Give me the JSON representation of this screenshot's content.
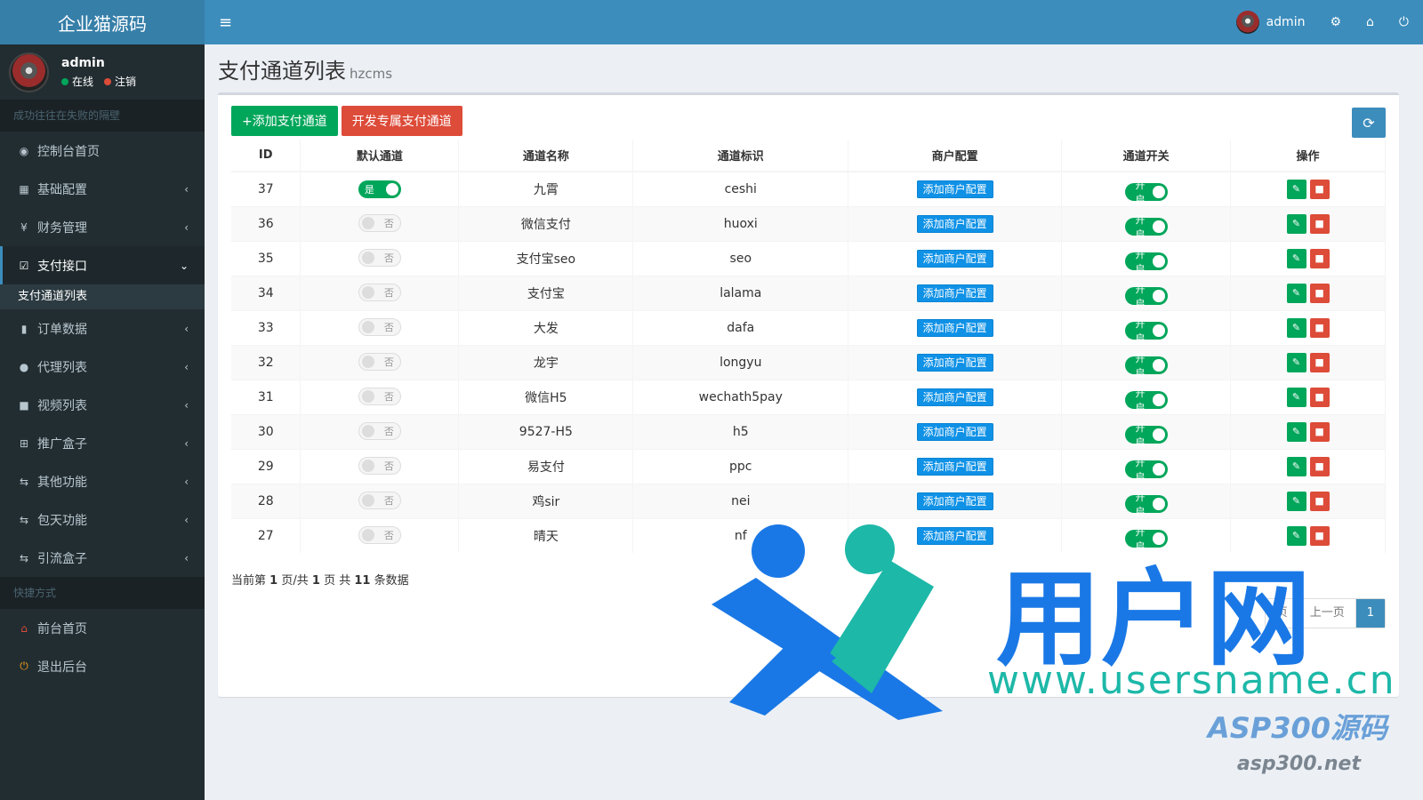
{
  "app": {
    "logo": "企业猫源码"
  },
  "user": {
    "name": "admin",
    "online": "在线",
    "logout": "注销"
  },
  "sidebar": {
    "motto": "成功往往在失败的隔壁",
    "items": [
      {
        "label": "控制台首页",
        "icon": "dashboard-icon"
      },
      {
        "label": "基础配置",
        "icon": "grid-icon"
      },
      {
        "label": "财务管理",
        "icon": "yen-icon"
      },
      {
        "label": "支付接口",
        "icon": "checkbox-icon"
      },
      {
        "label": "订单数据",
        "icon": "bar-chart-icon"
      },
      {
        "label": "代理列表",
        "icon": "users-icon"
      },
      {
        "label": "视频列表",
        "icon": "video-icon"
      },
      {
        "label": "推广盒子",
        "icon": "table-icon"
      },
      {
        "label": "其他功能",
        "icon": "exchange-icon"
      },
      {
        "label": "包天功能",
        "icon": "exchange-icon"
      },
      {
        "label": "引流盒子",
        "icon": "exchange-icon"
      }
    ],
    "active_sub": "支付通道列表",
    "quick_header": "快捷方式",
    "quick": [
      {
        "label": "前台首页"
      },
      {
        "label": "退出后台"
      }
    ]
  },
  "header": {
    "user": "admin"
  },
  "page": {
    "title": "支付通道列表",
    "subtitle": "hzcms"
  },
  "toolbar": {
    "add": "+添加支付通道",
    "dev": "开发专属支付通道"
  },
  "table": {
    "columns": [
      "ID",
      "默认通道",
      "通道名称",
      "通道标识",
      "商户配置",
      "通道开关",
      "操作"
    ],
    "merchant_btn": "添加商户配置",
    "on_label": "开启",
    "rows": [
      {
        "id": "37",
        "default": "是",
        "name": "九霄",
        "code": "ceshi"
      },
      {
        "id": "36",
        "default": "否",
        "name": "微信支付",
        "code": "huoxi"
      },
      {
        "id": "35",
        "default": "否",
        "name": "支付宝seo",
        "code": "seo"
      },
      {
        "id": "34",
        "default": "否",
        "name": "支付宝",
        "code": "lalama"
      },
      {
        "id": "33",
        "default": "否",
        "name": "大发",
        "code": "dafa"
      },
      {
        "id": "32",
        "default": "否",
        "name": "龙宇",
        "code": "longyu"
      },
      {
        "id": "31",
        "default": "否",
        "name": "微信H5",
        "code": "wechath5pay"
      },
      {
        "id": "30",
        "default": "否",
        "name": "9527-H5",
        "code": "h5"
      },
      {
        "id": "29",
        "default": "否",
        "name": "易支付",
        "code": "ppc"
      },
      {
        "id": "28",
        "default": "否",
        "name": "鸡sir",
        "code": "nei"
      },
      {
        "id": "27",
        "default": "否",
        "name": "晴天",
        "code": "nf"
      }
    ]
  },
  "pager": {
    "p1": "当前第",
    "cur": "1",
    "p2": "页/共",
    "total": "1",
    "p3": "页 共",
    "count": "11",
    "p4": "条数据",
    "buttons": [
      "页",
      "上一页",
      "1"
    ]
  },
  "watermark": {
    "big": "用户网",
    "url": "www.usersname.cn",
    "asp": "ASP300源码",
    "asp_url": "asp300.net"
  },
  "colors": {
    "primary": "#3c8dbc",
    "sidebar": "#222d32",
    "success": "#00a65a",
    "danger": "#dd4b39"
  }
}
